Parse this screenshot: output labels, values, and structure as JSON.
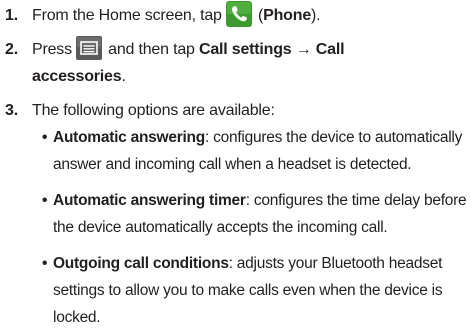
{
  "steps": [
    {
      "num": "1.",
      "before": "From the Home screen, tap",
      "paren_open": " (",
      "bold": "Phone",
      "after": ")."
    },
    {
      "num": "2.",
      "before": "Press",
      "mid": " and then tap ",
      "bold1": "Call settings → Call",
      "bold2": "accessories",
      "after": "."
    },
    {
      "num": "3.",
      "text": "The following options are available:"
    }
  ],
  "bullets": [
    {
      "term": "Automatic answering",
      "desc": ": configures the device to automatically answer and incoming call when a headset is detected."
    },
    {
      "term": "Automatic answering timer",
      "desc": ": configures the time delay before the device automatically accepts the incoming call."
    },
    {
      "term": "Outgoing call conditions",
      "desc": ": adjusts your Bluetooth headset settings to allow you to make calls even when the device is locked."
    }
  ],
  "bullet_char": "•",
  "icons": {
    "phone": "phone-app-icon",
    "menu": "menu-key-icon"
  },
  "colors": {
    "text": "#231f20",
    "phone_icon_bg": "#3c9a2f",
    "menu_icon_bg": "#5a5a5a"
  }
}
